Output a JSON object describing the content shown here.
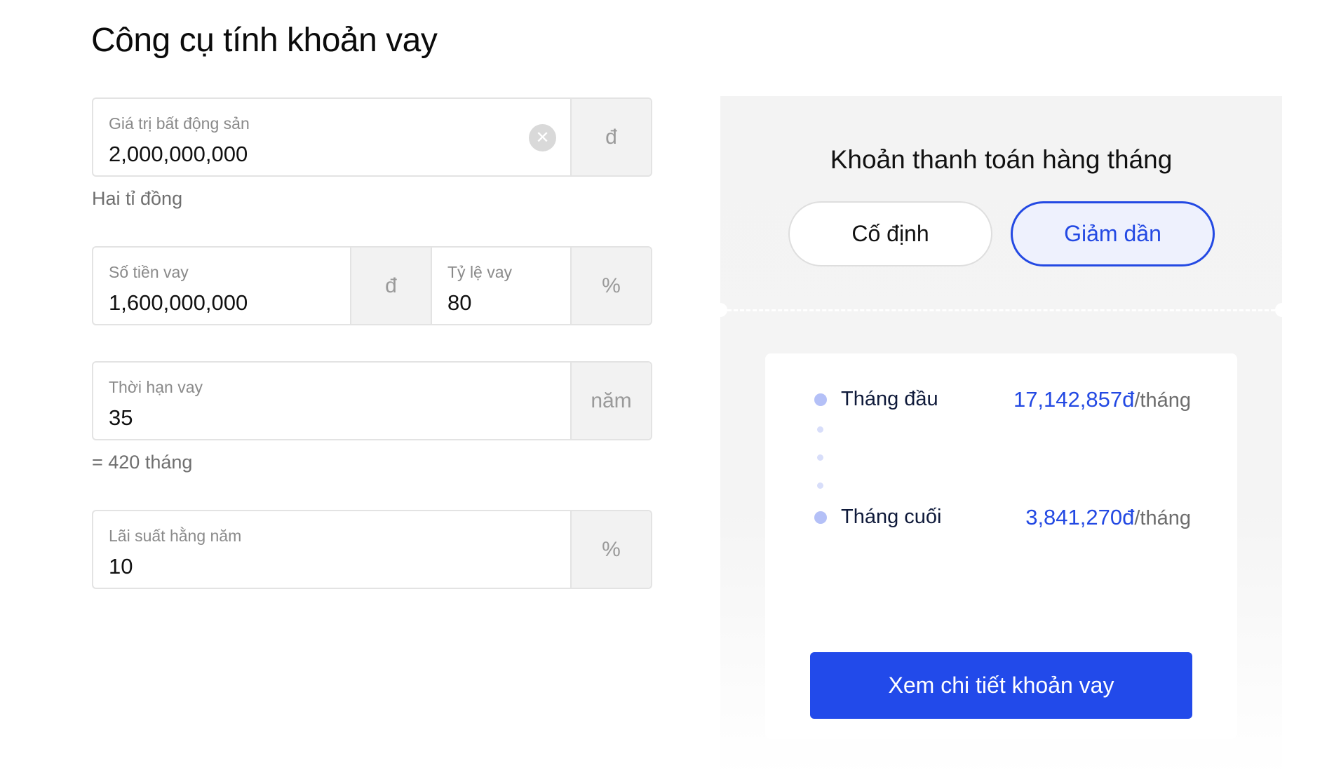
{
  "page": {
    "title": "Công cụ tính khoản vay"
  },
  "form": {
    "property_value": {
      "label": "Giá trị bất động sản",
      "value": "2,000,000,000",
      "suffix": "đ",
      "clear_icon": "x-circle-icon",
      "helper": "Hai tỉ đồng"
    },
    "loan_amount": {
      "label": "Số tiền vay",
      "value": "1,600,000,000",
      "suffix": "đ"
    },
    "loan_ratio": {
      "label": "Tỷ lệ vay",
      "value": "80",
      "suffix": "%"
    },
    "loan_term": {
      "label": "Thời hạn vay",
      "value": "35",
      "suffix": "năm",
      "helper": "= 420 tháng"
    },
    "interest_rate": {
      "label": "Lãi suất hằng năm",
      "value": "10",
      "suffix": "%"
    }
  },
  "result": {
    "title": "Khoản thanh toán hàng tháng",
    "modes": [
      {
        "label": "Cố định",
        "selected": false
      },
      {
        "label": "Giảm dần",
        "selected": true
      }
    ],
    "rows": [
      {
        "label": "Tháng đầu",
        "amount": "17,142,857đ",
        "unit": "/tháng"
      },
      {
        "label": "Tháng cuối",
        "amount": "3,841,270đ",
        "unit": "/tháng"
      }
    ],
    "cta_label": "Xem chi tiết khoản vay"
  },
  "colors": {
    "accent": "#224aea",
    "accent_light": "#eef1fd",
    "panel_bg": "#f3f3f3",
    "dot": "#b4c0f7"
  }
}
